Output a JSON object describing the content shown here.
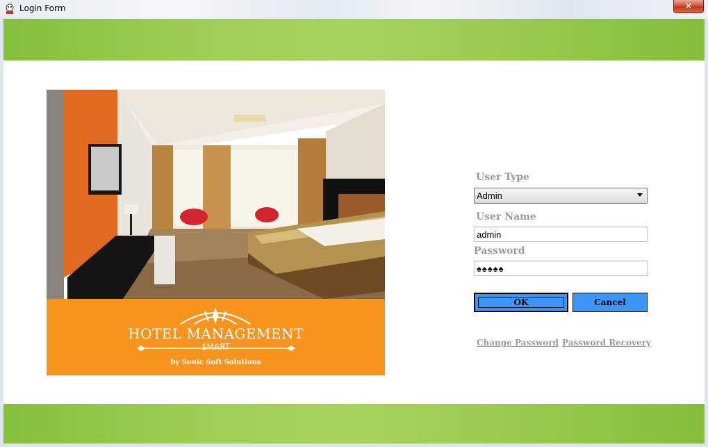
{
  "window": {
    "title": "Login Form",
    "close_label": "✕"
  },
  "banner": {
    "logo_title": "HOTEL MANAGEMENT",
    "logo_subtitle": "$MART",
    "logo_by": "by  Sonic Soft Solutions"
  },
  "form": {
    "user_type": {
      "label": "User Type",
      "value": "Admin"
    },
    "user_name": {
      "label": "User Name",
      "value": "admin"
    },
    "password": {
      "label": "Password",
      "value": "♠♠♠♠♠"
    },
    "ok_label": "OK",
    "cancel_label": "Cancel",
    "change_password_label": "Change Password",
    "password_recovery_label": "Password Recovery"
  },
  "colors": {
    "accent_green": "#9fcf55",
    "brand_orange": "#f7941d",
    "button_blue": "#3d96f5"
  }
}
